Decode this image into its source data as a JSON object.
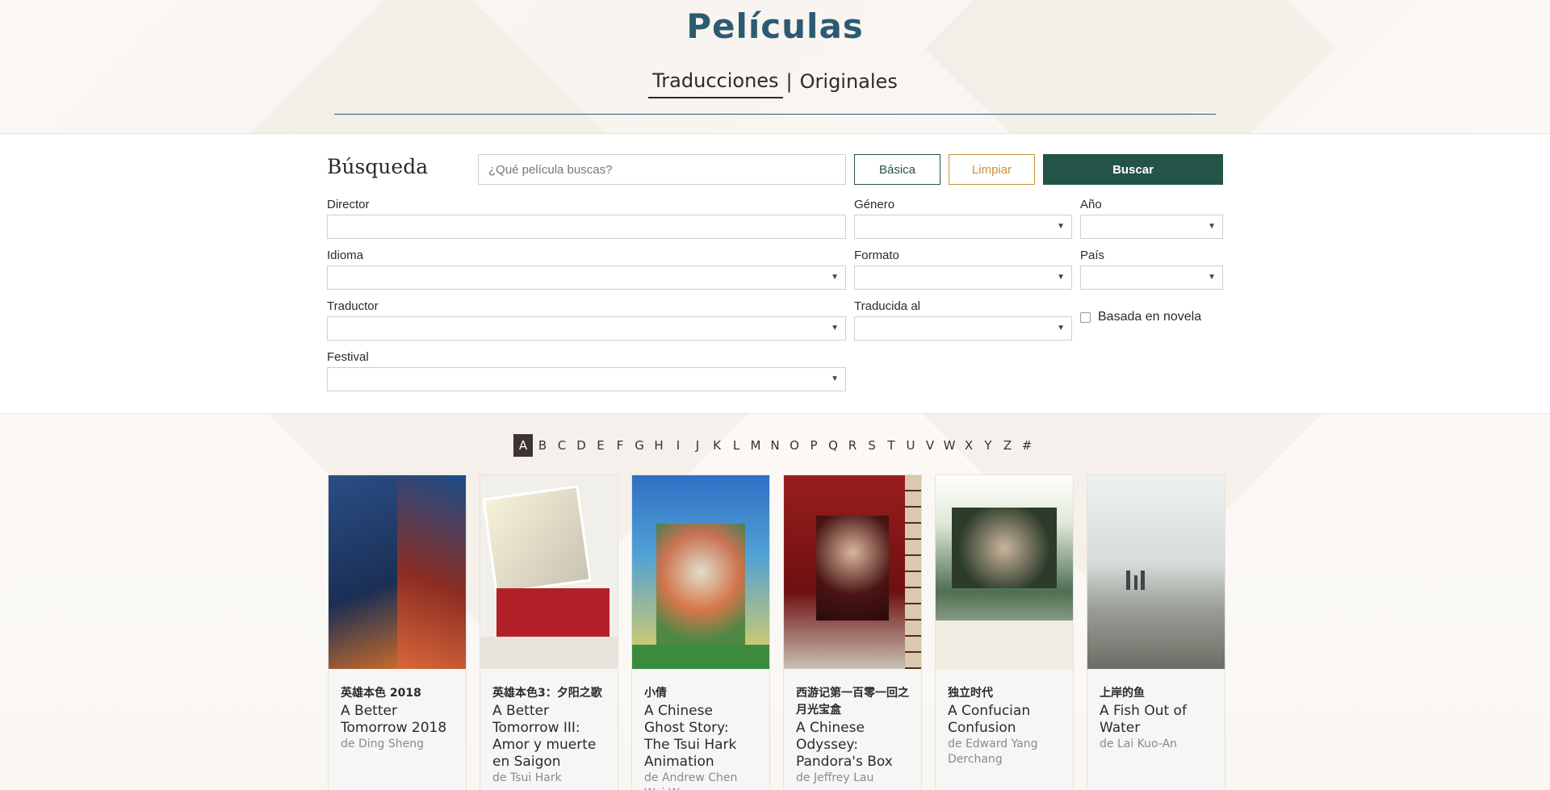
{
  "header": {
    "title": "Películas",
    "tabs": [
      {
        "label": "Traducciones",
        "active": true
      },
      {
        "label": "Originales",
        "active": false
      }
    ],
    "tab_separator": "|"
  },
  "search": {
    "title": "Búsqueda",
    "placeholder": "¿Qué película buscas?",
    "buttons": {
      "basic": "Básica",
      "clear": "Limpiar",
      "search": "Buscar"
    },
    "fields": {
      "director": "Director",
      "genre": "Género",
      "year": "Año",
      "language": "Idioma",
      "format": "Formato",
      "country": "País",
      "translator": "Traductor",
      "translated_to": "Traducida al",
      "novel": "Basada en novela",
      "festival": "Festival"
    },
    "novel_checked": false,
    "caret": "▼"
  },
  "alphabet": {
    "letters": [
      "A",
      "B",
      "C",
      "D",
      "E",
      "F",
      "G",
      "H",
      "I",
      "J",
      "K",
      "L",
      "M",
      "N",
      "O",
      "P",
      "Q",
      "R",
      "S",
      "T",
      "U",
      "V",
      "W",
      "X",
      "Y",
      "Z",
      "#"
    ],
    "active": "A"
  },
  "films": [
    {
      "native": "英雄本色 2018",
      "title": "A Better Tomorrow 2018",
      "director": "de Ding Sheng",
      "poster_colors": [
        "#1c3d6b",
        "#c2412a"
      ]
    },
    {
      "native": "英雄本色3：夕阳之歌",
      "title": "A Better Tomorrow III: Amor y muerte en Saigon",
      "director": "de Tsui Hark",
      "poster_colors": [
        "#eaeaea",
        "#b8202a"
      ]
    },
    {
      "native": "小倩",
      "title": "A Chinese Ghost Story: The Tsui Hark Animation",
      "director": "de Andrew Chen Wei-Wen",
      "poster_colors": [
        "#2e6fc1",
        "#e9c843"
      ]
    },
    {
      "native": "西游记第一百零一回之月光宝盒",
      "title": "A Chinese Odyssey: Pandora's Box",
      "director": "de Jeffrey Lau",
      "poster_colors": [
        "#8a1a1a",
        "#d8d2c8"
      ]
    },
    {
      "native": "独立时代",
      "title": "A Confucian Confusion",
      "director": "de Edward Yang Derchang",
      "poster_colors": [
        "#3b5f3a",
        "#e9e3d6"
      ]
    },
    {
      "native": "上岸的鱼",
      "title": "A Fish Out of Water",
      "director": "de Lai Kuo-An",
      "poster_colors": [
        "#cfd6d3",
        "#8a8c86"
      ]
    }
  ]
}
